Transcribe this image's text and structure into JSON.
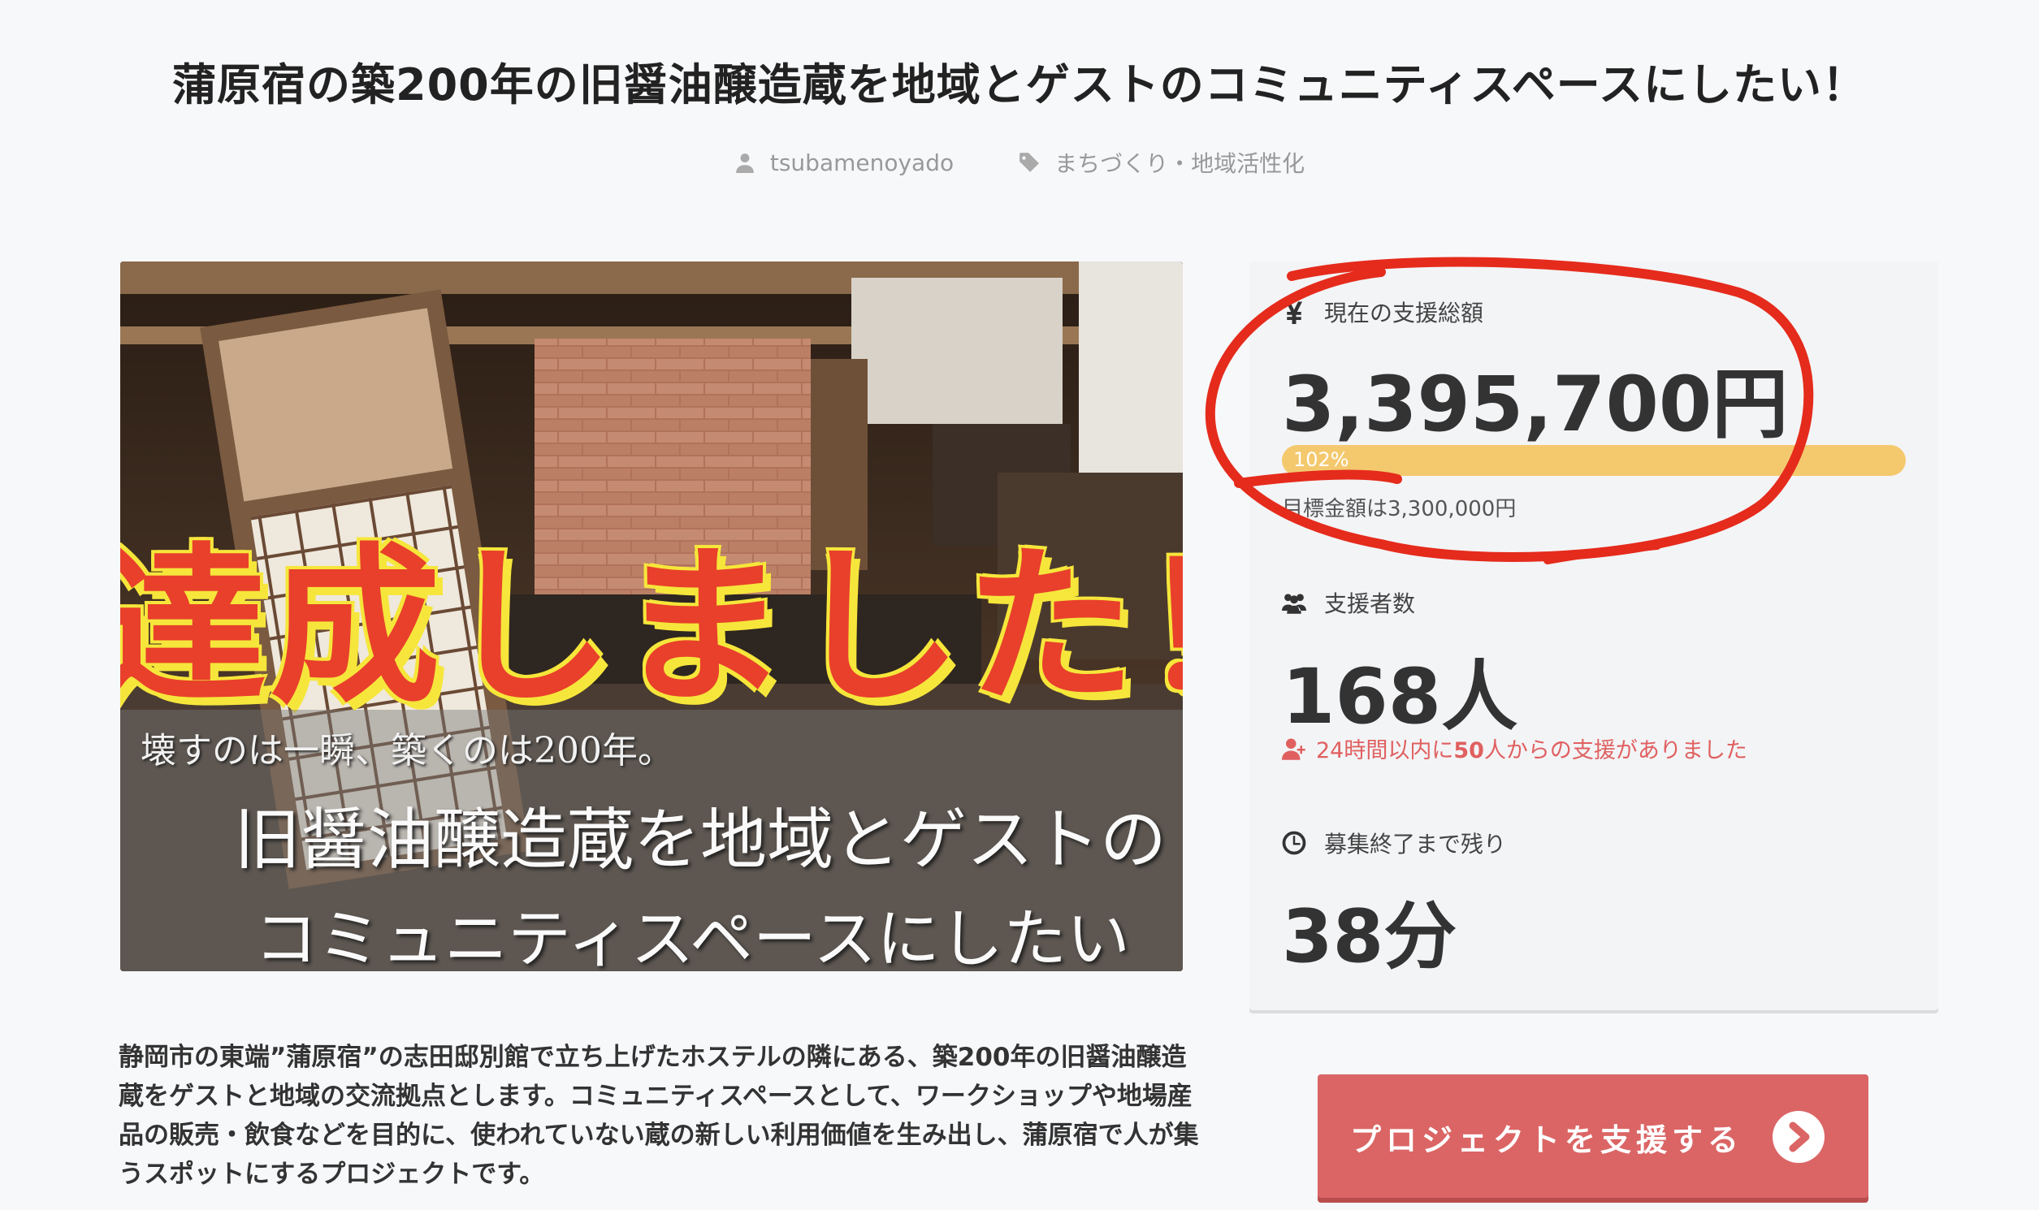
{
  "project": {
    "title": "蒲原宿の築200年の旧醤油醸造蔵を地域とゲストのコミュニティスペースにしたい！",
    "owner": "tsubamenoyado",
    "category": "まちづくり・地域活性化"
  },
  "hero": {
    "achieved_text": "達成しました！",
    "caption_small": "壊すのは一瞬、築くのは200年。",
    "caption_line1": "旧醤油醸造蔵を地域とゲストの",
    "caption_line2": "コミュニティスペースにしたい"
  },
  "stats": {
    "amount_label": "現在の支援総額",
    "amount": "3,395,700円",
    "progress_percent": 102,
    "progress_label": "102%",
    "goal_text": "目標金額は3,300,000円",
    "supporters_label": "支援者数",
    "supporters": "168人",
    "recent_prefix": "24時間以内に",
    "recent_count": "50",
    "recent_suffix": "人からの支援がありました",
    "remaining_label": "募集終了まで残り",
    "remaining": "38分"
  },
  "description": "静岡市の東端”蒲原宿”の志田邸別館で立ち上げたホステルの隣にある、築200年の旧醤油醸造蔵をゲストと地域の交流拠点とします。コミュニティスペースとして、ワークショップや地場産品の販売・飲食などを目的に、使われていない蔵の新しい利用価値を生み出し、蒲原宿で人が集うスポットにするプロジェクトです。",
  "support_button": {
    "label": "プロジェクトを支援する"
  },
  "icons": [
    "user-icon",
    "tag-icon",
    "yen-icon",
    "users-icon",
    "user-plus-icon",
    "clock-icon",
    "chevron-right-icon"
  ],
  "colors": {
    "progress": "#f4c96e",
    "button": "#db6565",
    "annotation": "#e52b1c",
    "achieved_text": "#e8402b",
    "achieved_shadow": "#f6e63b"
  }
}
